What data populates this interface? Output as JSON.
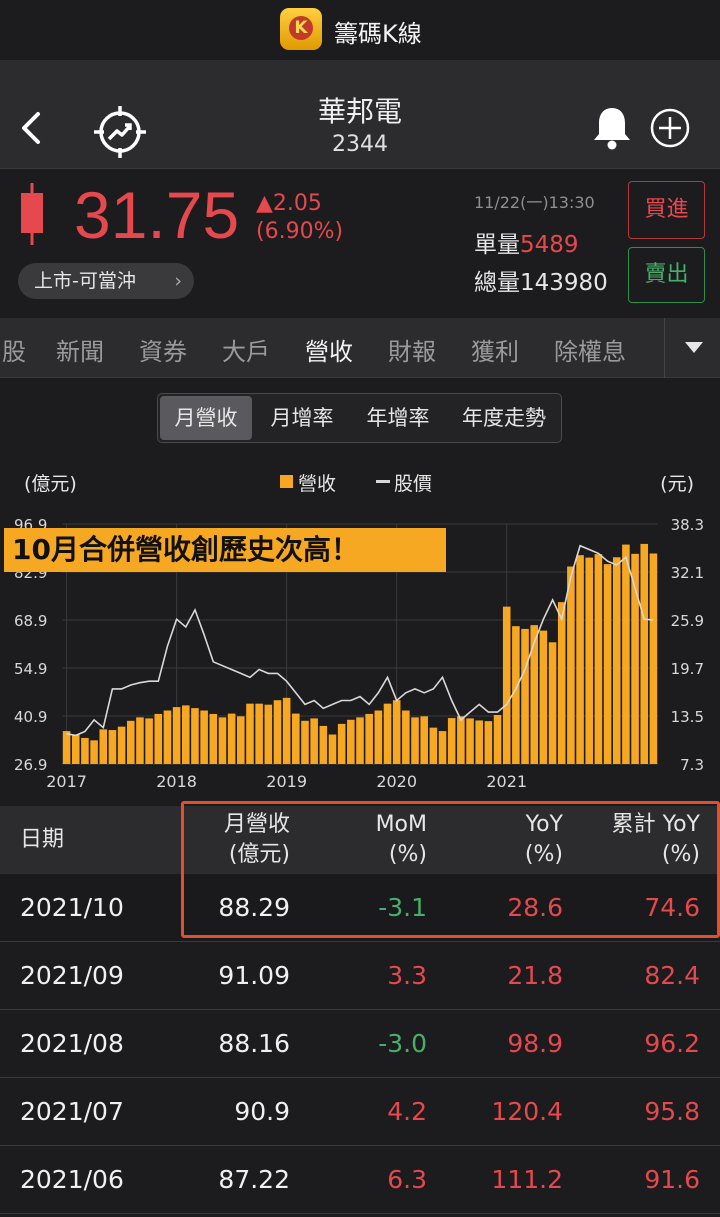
{
  "app": {
    "title": "籌碼K線",
    "logo_letter": "K"
  },
  "stock": {
    "name": "華邦電",
    "code": "2344"
  },
  "quote": {
    "price": "31.75",
    "change": "▲2.05",
    "change_pct": "(6.90%)",
    "market_tag": "上市-可當沖",
    "time": "11/22(一)13:30",
    "volume_label": "單量",
    "volume": "5489",
    "total_label": "總量",
    "total": "143980",
    "buy_label": "買進",
    "sell_label": "賣出",
    "colors": {
      "up": "#e5484d",
      "down": "#46b06a"
    }
  },
  "tabs": [
    "股",
    "新聞",
    "資券",
    "大戶",
    "營收",
    "財報",
    "獲利",
    "除權息"
  ],
  "active_tab": "營收",
  "segments": [
    "月營收",
    "月增率",
    "年增率",
    "年度走勢"
  ],
  "active_segment": "月營收",
  "banner": "10月合併營收創歷史次高！",
  "chart_data": {
    "type": "bar",
    "left_axis_label": "(億元)",
    "right_axis_label": "(元)",
    "legend": [
      {
        "name": "營收",
        "marker": "bar",
        "color": "#f7a823"
      },
      {
        "name": "股價",
        "marker": "line",
        "color": "#d8d8d8"
      }
    ],
    "y_ticks_left": [
      "96.9",
      "82.9",
      "68.9",
      "54.9",
      "40.9",
      "26.9"
    ],
    "y_ticks_right": [
      "38.3",
      "32.1",
      "25.9",
      "19.7",
      "13.5",
      "7.3"
    ],
    "ylim_left": [
      26.9,
      96.9
    ],
    "ylim_right": [
      7.3,
      38.3
    ],
    "x_ticks": [
      "2017",
      "2018",
      "2019",
      "2020",
      "2021"
    ],
    "revenue": [
      36.5,
      35.5,
      34.5,
      33.8,
      37.0,
      36.8,
      37.8,
      39.5,
      40.5,
      40.2,
      41.5,
      42.5,
      43.5,
      44.0,
      43.2,
      42.5,
      41.5,
      40.5,
      41.6,
      40.8,
      44.5,
      44.5,
      44.2,
      45.5,
      46.2,
      41.6,
      39.5,
      40.2,
      38.0,
      35.5,
      38.6,
      39.8,
      40.5,
      41.5,
      42.5,
      44.5,
      45.5,
      42.5,
      40.5,
      40.8,
      37.5,
      36.5,
      40.3,
      40.8,
      40.2,
      39.6,
      39.4,
      41.2,
      72.8,
      67.1,
      66.3,
      67.4,
      65.8,
      62.4,
      74.1,
      84.5,
      87.8,
      87.1,
      88.1,
      85.2,
      87.2,
      90.9,
      88.2,
      91.1,
      88.3
    ],
    "price": [
      11.2,
      11.0,
      11.5,
      13.0,
      12.0,
      17.0,
      17.0,
      17.5,
      17.8,
      18.0,
      18.0,
      22.5,
      26.0,
      25.0,
      27.2,
      24.0,
      20.5,
      20.0,
      19.5,
      19.0,
      18.5,
      19.5,
      19.0,
      19.0,
      18.0,
      16.5,
      15.0,
      15.5,
      14.5,
      15.0,
      15.5,
      15.5,
      16.0,
      15.0,
      16.5,
      18.5,
      15.5,
      16.5,
      17.0,
      16.5,
      17.0,
      18.5,
      15.5,
      13.0,
      14.0,
      15.0,
      14.0,
      14.0,
      15.0,
      17.0,
      19.5,
      23.0,
      26.0,
      28.5,
      26.0,
      31.5,
      35.5,
      35.0,
      34.5,
      33.5,
      33.0,
      34.0,
      30.0,
      26.0,
      25.9
    ]
  },
  "table": {
    "headers": {
      "date": "日期",
      "rev": [
        "月營收",
        "(億元)"
      ],
      "mom": [
        "MoM",
        "(%)"
      ],
      "yoy": [
        "YoY",
        "(%)"
      ],
      "cum": [
        "累計 YoY",
        "(%)"
      ]
    },
    "rows": [
      {
        "date": "2021/10",
        "rev": "88.29",
        "mom": "-3.1",
        "yoy": "28.6",
        "cum": "74.6"
      },
      {
        "date": "2021/09",
        "rev": "91.09",
        "mom": "3.3",
        "yoy": "21.8",
        "cum": "82.4"
      },
      {
        "date": "2021/08",
        "rev": "88.16",
        "mom": "-3.0",
        "yoy": "98.9",
        "cum": "96.2"
      },
      {
        "date": "2021/07",
        "rev": "90.9",
        "mom": "4.2",
        "yoy": "120.4",
        "cum": "95.8"
      },
      {
        "date": "2021/06",
        "rev": "87.22",
        "mom": "6.3",
        "yoy": "111.2",
        "cum": "91.6"
      }
    ]
  }
}
